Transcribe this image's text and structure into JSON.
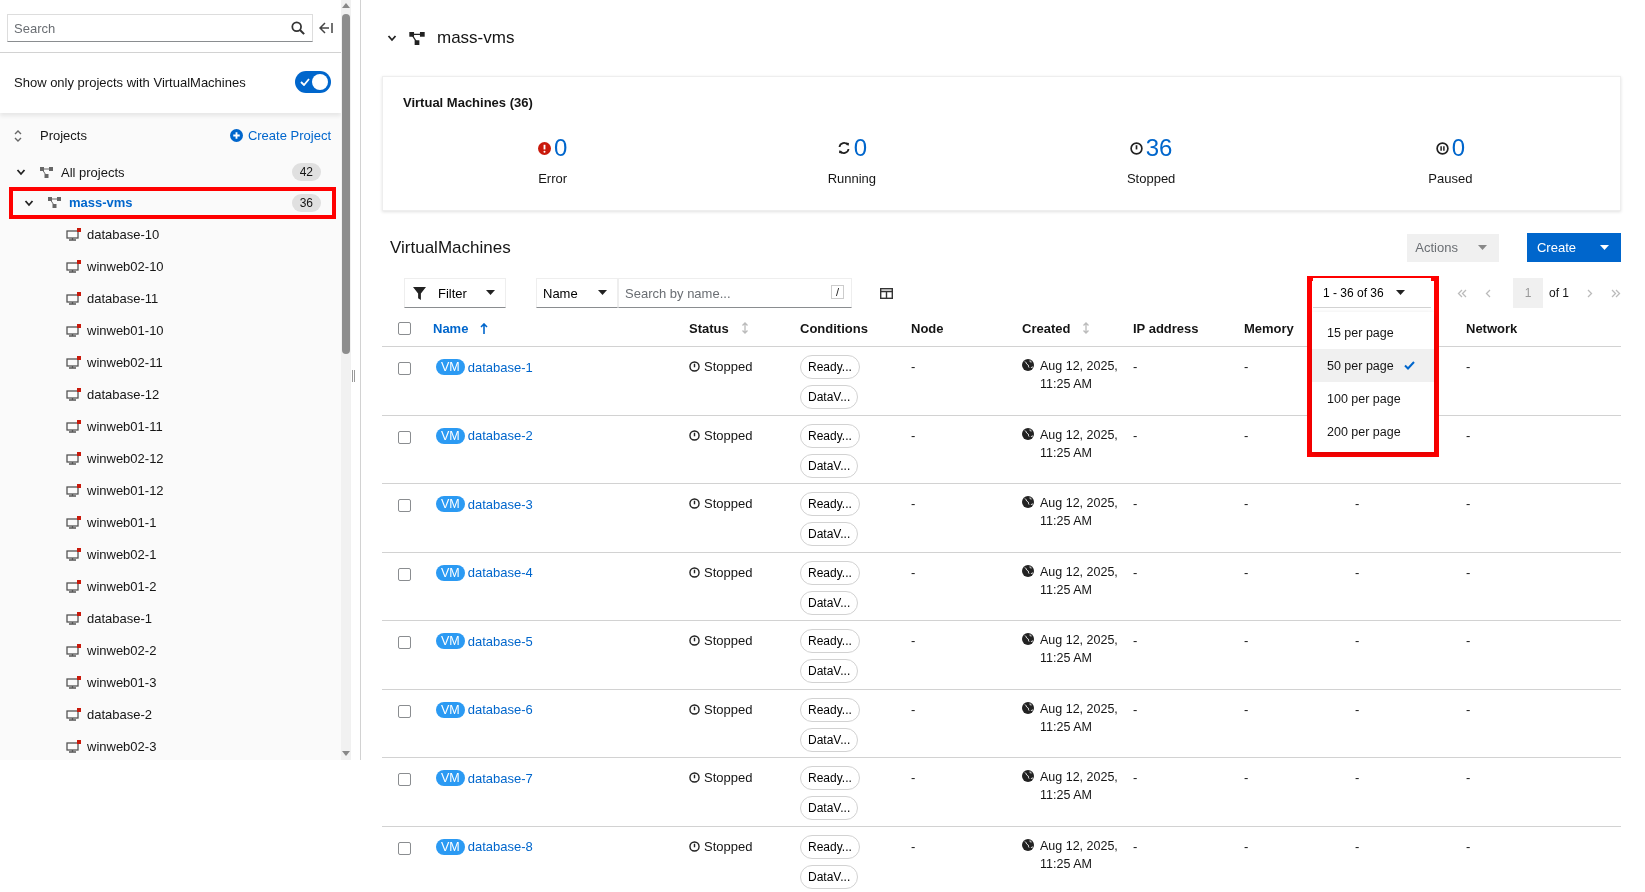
{
  "sidebar": {
    "search": {
      "placeholder": "Search"
    },
    "filter_toggle": {
      "label": "Show only projects with VirtualMachines",
      "on": true
    },
    "projects_label": "Projects",
    "create_project": "Create Project",
    "tree": [
      {
        "label": "All projects",
        "count": "42",
        "expanded": true,
        "selected": false,
        "children": [
          {
            "label": "mass-vms",
            "count": "36",
            "expanded": true,
            "selected": true,
            "highlighted": true,
            "children": [
              {
                "label": "database-10"
              },
              {
                "label": "winweb02-10"
              },
              {
                "label": "database-11"
              },
              {
                "label": "winweb01-10"
              },
              {
                "label": "winweb02-11"
              },
              {
                "label": "database-12"
              },
              {
                "label": "winweb01-11"
              },
              {
                "label": "winweb02-12"
              },
              {
                "label": "winweb01-12"
              },
              {
                "label": "winweb01-1"
              },
              {
                "label": "winweb02-1"
              },
              {
                "label": "winweb01-2"
              },
              {
                "label": "database-1"
              },
              {
                "label": "winweb02-2"
              },
              {
                "label": "winweb01-3"
              },
              {
                "label": "database-2"
              },
              {
                "label": "winweb02-3"
              }
            ]
          }
        ]
      }
    ]
  },
  "header": {
    "project": "mass-vms",
    "expanded": true
  },
  "summary": {
    "title": "Virtual Machines (36)",
    "stats": [
      {
        "kind": "error",
        "value": "0",
        "label": "Error"
      },
      {
        "kind": "running",
        "value": "0",
        "label": "Running"
      },
      {
        "kind": "stopped",
        "value": "36",
        "label": "Stopped"
      },
      {
        "kind": "paused",
        "value": "0",
        "label": "Paused"
      }
    ]
  },
  "list": {
    "title": "VirtualMachines",
    "actions": "Actions",
    "create": "Create",
    "filter": "Filter",
    "search_by": "Name",
    "search_placeholder": "Search by name...",
    "shortcut": "/",
    "pagination": {
      "range": "1 - 36 of 36",
      "page": "1",
      "of": "of 1",
      "highlighted": true,
      "menu": [
        {
          "label": "15 per page",
          "selected": false
        },
        {
          "label": "50 per page",
          "selected": true
        },
        {
          "label": "100 per page",
          "selected": false
        },
        {
          "label": "200 per page",
          "selected": false
        }
      ]
    }
  },
  "table": {
    "select_all_checked": false,
    "columns": [
      {
        "label": "Name",
        "sorted_ascending": true
      },
      {
        "label": "Status",
        "sortable": true
      },
      {
        "label": "Conditions"
      },
      {
        "label": "Node"
      },
      {
        "label": "Created",
        "sortable": true
      },
      {
        "label": "IP address"
      },
      {
        "label": "Memory"
      },
      {
        "label": "Network"
      }
    ],
    "rows": [
      {
        "checked": false,
        "badge": "VM",
        "name": "database-1",
        "status": "Stopped",
        "conditions": [
          "Ready...",
          "DataV..."
        ],
        "node": "-",
        "created": "Aug 12, 2025, 11:25 AM",
        "ip": "-",
        "memory": "-",
        "network": "-"
      },
      {
        "checked": false,
        "badge": "VM",
        "name": "database-2",
        "status": "Stopped",
        "conditions": [
          "Ready...",
          "DataV..."
        ],
        "node": "-",
        "created": "Aug 12, 2025, 11:25 AM",
        "ip": "-",
        "memory": "-",
        "network": "-"
      },
      {
        "checked": false,
        "badge": "VM",
        "name": "database-3",
        "status": "Stopped",
        "conditions": [
          "Ready...",
          "DataV..."
        ],
        "node": "-",
        "created": "Aug 12, 2025, 11:25 AM",
        "ip": "-",
        "memory": "-",
        "column_8": "-",
        "network": "-"
      },
      {
        "checked": false,
        "badge": "VM",
        "name": "database-4",
        "status": "Stopped",
        "conditions": [
          "Ready...",
          "DataV..."
        ],
        "node": "-",
        "created": "Aug 12, 2025, 11:25 AM",
        "ip": "-",
        "memory": "-",
        "column_8": "-",
        "network": "-"
      },
      {
        "checked": false,
        "badge": "VM",
        "name": "database-5",
        "status": "Stopped",
        "conditions": [
          "Ready...",
          "DataV..."
        ],
        "node": "-",
        "created": "Aug 12, 2025, 11:25 AM",
        "ip": "-",
        "memory": "-",
        "column_8": "-",
        "network": "-"
      },
      {
        "checked": false,
        "badge": "VM",
        "name": "database-6",
        "status": "Stopped",
        "conditions": [
          "Ready...",
          "DataV..."
        ],
        "node": "-",
        "created": "Aug 12, 2025, 11:25 AM",
        "ip": "-",
        "memory": "-",
        "column_8": "-",
        "network": "-"
      },
      {
        "checked": false,
        "badge": "VM",
        "name": "database-7",
        "status": "Stopped",
        "conditions": [
          "Ready...",
          "DataV..."
        ],
        "node": "-",
        "created": "Aug 12, 2025, 11:25 AM",
        "ip": "-",
        "memory": "-",
        "column_8": "-",
        "network": "-"
      },
      {
        "checked": false,
        "badge": "VM",
        "name": "database-8",
        "status": "Stopped",
        "conditions": [
          "Ready...",
          "DataV..."
        ],
        "node": "-",
        "created": "Aug 12, 2025, 11:25 AM",
        "ip": "-",
        "memory": "-",
        "column_8": "-",
        "network": "-"
      }
    ]
  }
}
